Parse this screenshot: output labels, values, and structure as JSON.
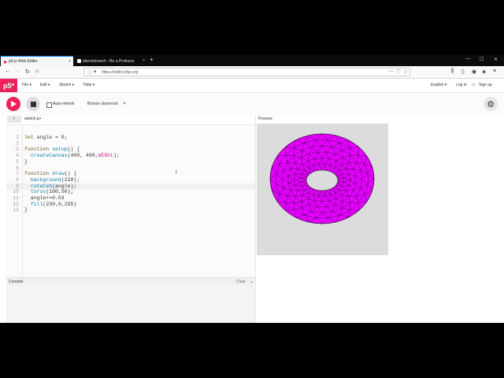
{
  "browser": {
    "tabs": [
      {
        "title": "p5.js Web Editor"
      },
      {
        "title": "sbeolsbranch - Be a Professo"
      }
    ],
    "url": "https://editor.p5js.org"
  },
  "header": {
    "logo": "p5*",
    "menus": [
      "File ▾",
      "Edit ▾",
      "Sketch ▾",
      "Help ▾"
    ],
    "language": "English ▾",
    "login": "Log in",
    "or": "or",
    "signup": "Sign up"
  },
  "toolbar": {
    "autorefresh": "Auto-refresh",
    "sketch_name": "Bronze shamrock"
  },
  "editor": {
    "filename": "sketch.js",
    "lines": [
      {
        "n": "1",
        "text": "let angle = 0;"
      },
      {
        "n": "2",
        "text": ""
      },
      {
        "n": "3",
        "text": "function setup() {"
      },
      {
        "n": "4",
        "text": "  createCanvas(400, 400,WEBGL);"
      },
      {
        "n": "5",
        "text": "}"
      },
      {
        "n": "6",
        "text": ""
      },
      {
        "n": "7",
        "text": "function draw() {"
      },
      {
        "n": "8",
        "text": "  background(220);"
      },
      {
        "n": "9",
        "text": "  rotateX(angle);"
      },
      {
        "n": "10",
        "text": "  torus(100,50);"
      },
      {
        "n": "11",
        "text": "  angle+=0.03"
      },
      {
        "n": "12",
        "text": "  fill(230,0,255)"
      },
      {
        "n": "13",
        "text": "}"
      }
    ]
  },
  "console": {
    "title": "Console",
    "clear": "Clear"
  },
  "preview": {
    "label": "Preview",
    "torus_color": "#e600ff",
    "background_color": "#dcdcdc"
  },
  "colors": {
    "accent": "#ed225d"
  }
}
